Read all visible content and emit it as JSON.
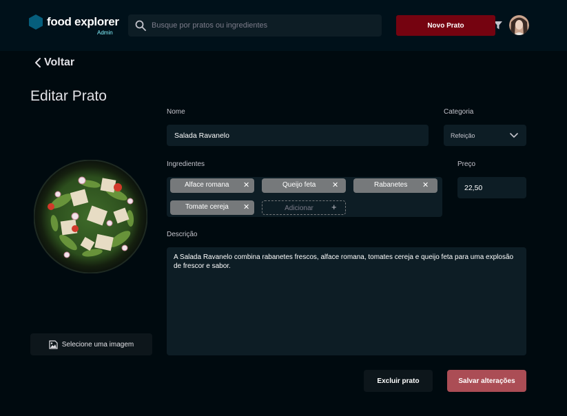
{
  "header": {
    "logo_text": "food explorer",
    "admin_tag": "Admin",
    "search_placeholder": "Busque por pratos ou ingredientes",
    "new_button": "Novo Prato"
  },
  "nav": {
    "back_label": "Voltar"
  },
  "page": {
    "title": "Editar Prato"
  },
  "image_section": {
    "button_label": "Selecione uma imagem"
  },
  "form": {
    "name_label": "Nome",
    "name_value": "Salada Ravanelo",
    "category_label": "Categoria",
    "category_value": "Refeição",
    "ingredients_label": "Ingredientes",
    "ingredients": [
      {
        "label": "Alface romana"
      },
      {
        "label": "Queijo feta"
      },
      {
        "label": "Rabanetes"
      },
      {
        "label": "Tomate cereja"
      }
    ],
    "add_ingredient_placeholder": "Adicionar",
    "price_label": "Preço",
    "price_value": "22,50",
    "description_label": "Descrição",
    "description_value": "A Salada Ravanelo combina rabanetes frescos, alface romana, tomates cereja e queijo feta para uma explosão de frescor e sabor."
  },
  "actions": {
    "delete_label": "Excluir prato",
    "save_label": "Salvar alterações"
  },
  "colors": {
    "background": "#000a0f",
    "header": "#00111a",
    "input": "#0d1d25",
    "primary_button": "#750310",
    "save_button": "#ab4d55",
    "tag": "#76797b",
    "logo_hex": "#065e7c",
    "admin_accent": "#82f3ff"
  }
}
